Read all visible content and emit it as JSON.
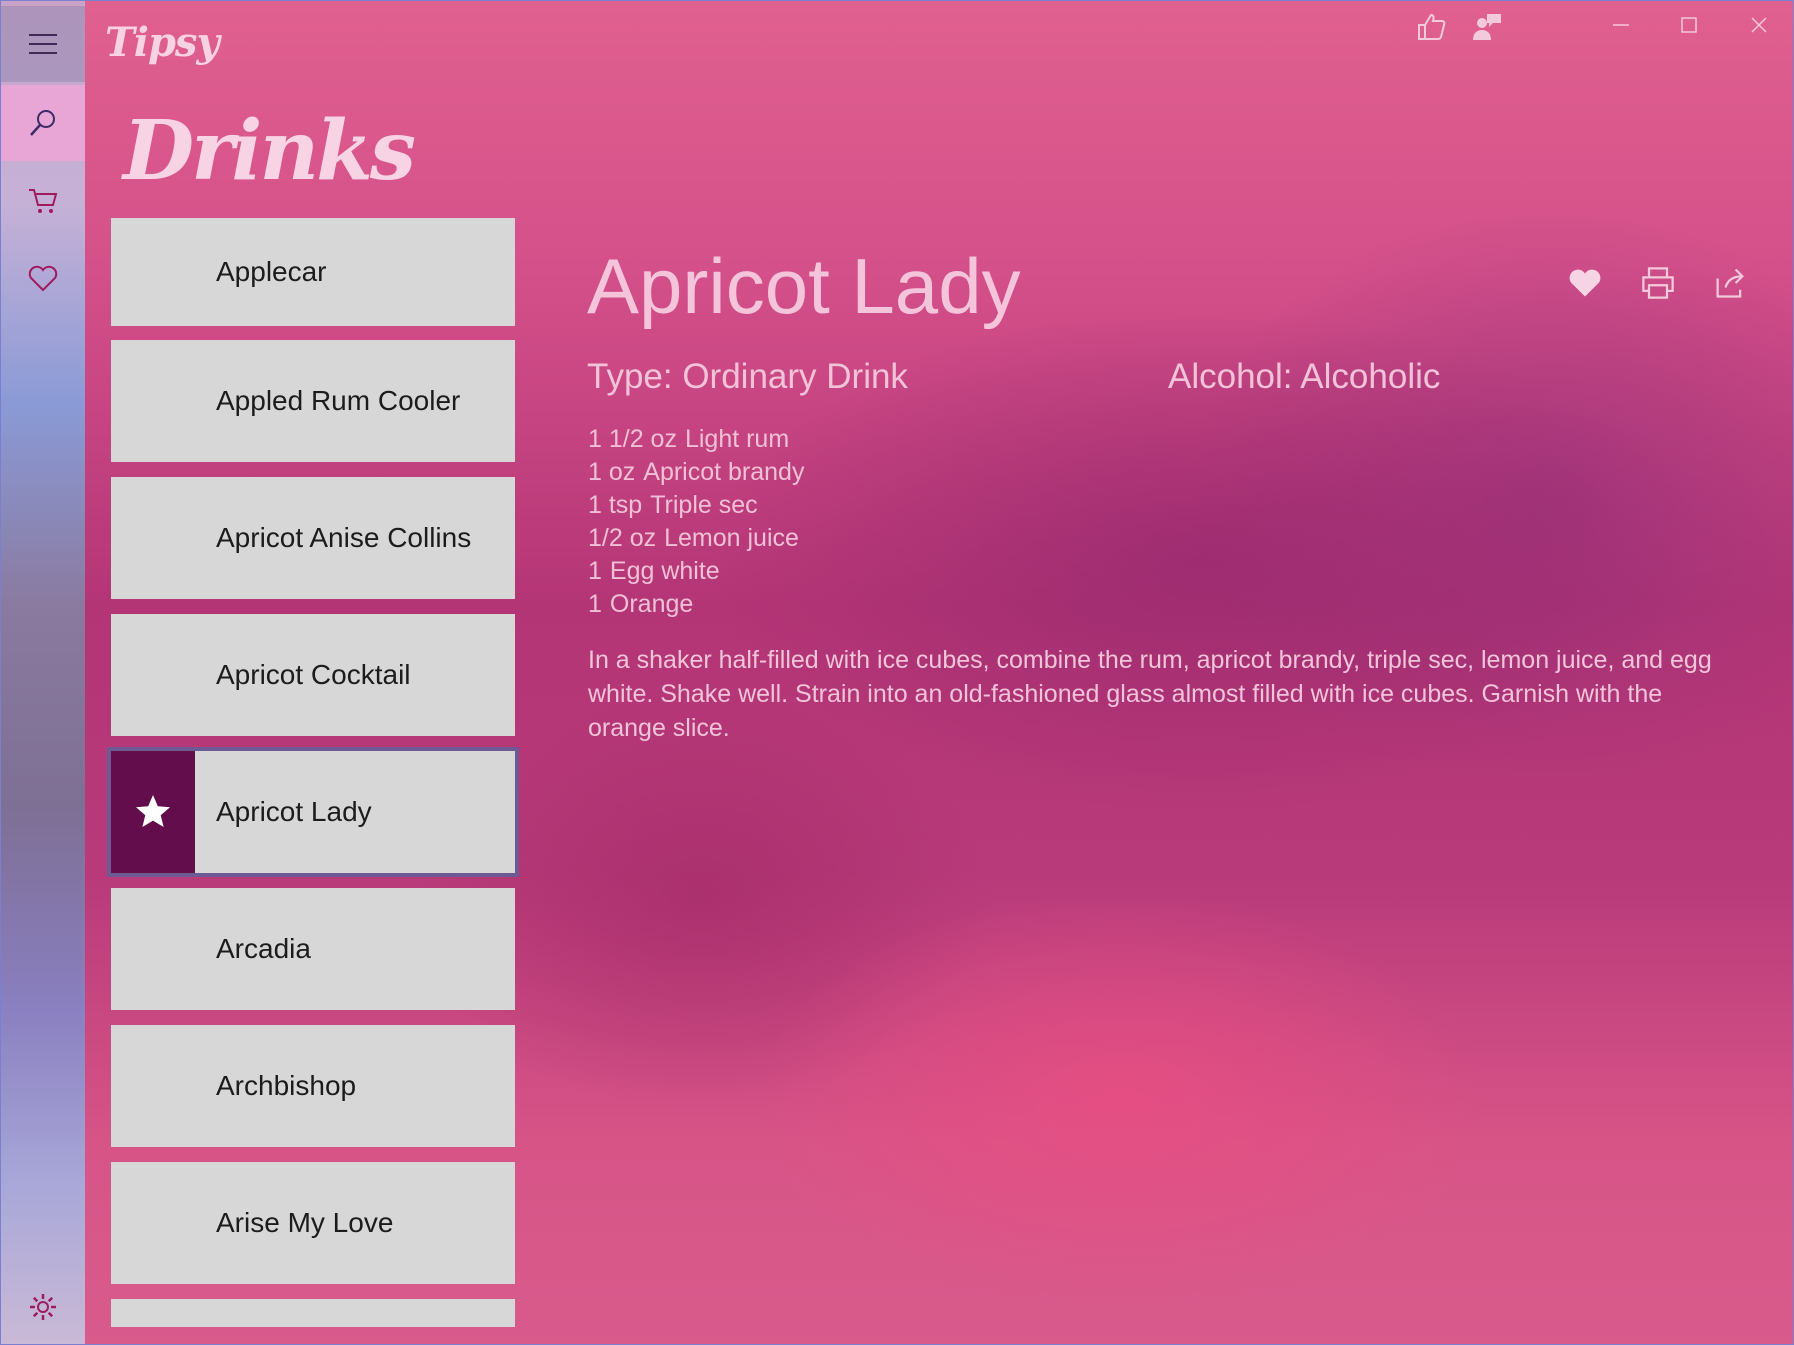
{
  "app": {
    "title": "Tipsy",
    "page_title": "Drinks"
  },
  "nav": {
    "items": [
      {
        "icon": "hamburger-icon"
      },
      {
        "icon": "search-icon",
        "active": true
      },
      {
        "icon": "cart-icon"
      },
      {
        "icon": "heart-icon"
      },
      {
        "icon": "gear-icon"
      }
    ]
  },
  "titlebar": {
    "icons": [
      "thumbs-up-icon",
      "person-feedback-icon"
    ],
    "controls": [
      "minimize",
      "maximize",
      "close"
    ]
  },
  "drinks": [
    {
      "name": "Applecar"
    },
    {
      "name": "Appled Rum Cooler"
    },
    {
      "name": "Apricot Anise Collins"
    },
    {
      "name": "Apricot Cocktail"
    },
    {
      "name": "Apricot Lady",
      "selected": true,
      "favorite": true
    },
    {
      "name": "Arcadia"
    },
    {
      "name": "Archbishop"
    },
    {
      "name": "Arise My Love"
    }
  ],
  "detail": {
    "title": "Apricot Lady",
    "type": "Type: Ordinary Drink",
    "alcohol": "Alcohol: Alcoholic",
    "ingredients": [
      {
        "qty": "1 1/2 oz",
        "item": "Light rum"
      },
      {
        "qty": "1 oz",
        "item": "Apricot brandy"
      },
      {
        "qty": "1 tsp",
        "item": "Triple sec"
      },
      {
        "qty": "1/2 oz",
        "item": "Lemon juice"
      },
      {
        "qty": "1",
        "item": "Egg white"
      },
      {
        "qty": "1",
        "item": "Orange"
      }
    ],
    "instructions": "In a shaker half-filled with ice cubes, combine the rum, apricot brandy, triple sec, lemon juice, and egg white. Shake well. Strain into an old-fashioned glass almost filled with ice cubes. Garnish with the orange slice.",
    "actions": [
      "heart-icon",
      "print-icon",
      "share-icon"
    ]
  },
  "colors": {
    "accent": "#640d4d",
    "item_bg": "#d7d7d7",
    "text_light": "#f4c5da"
  }
}
